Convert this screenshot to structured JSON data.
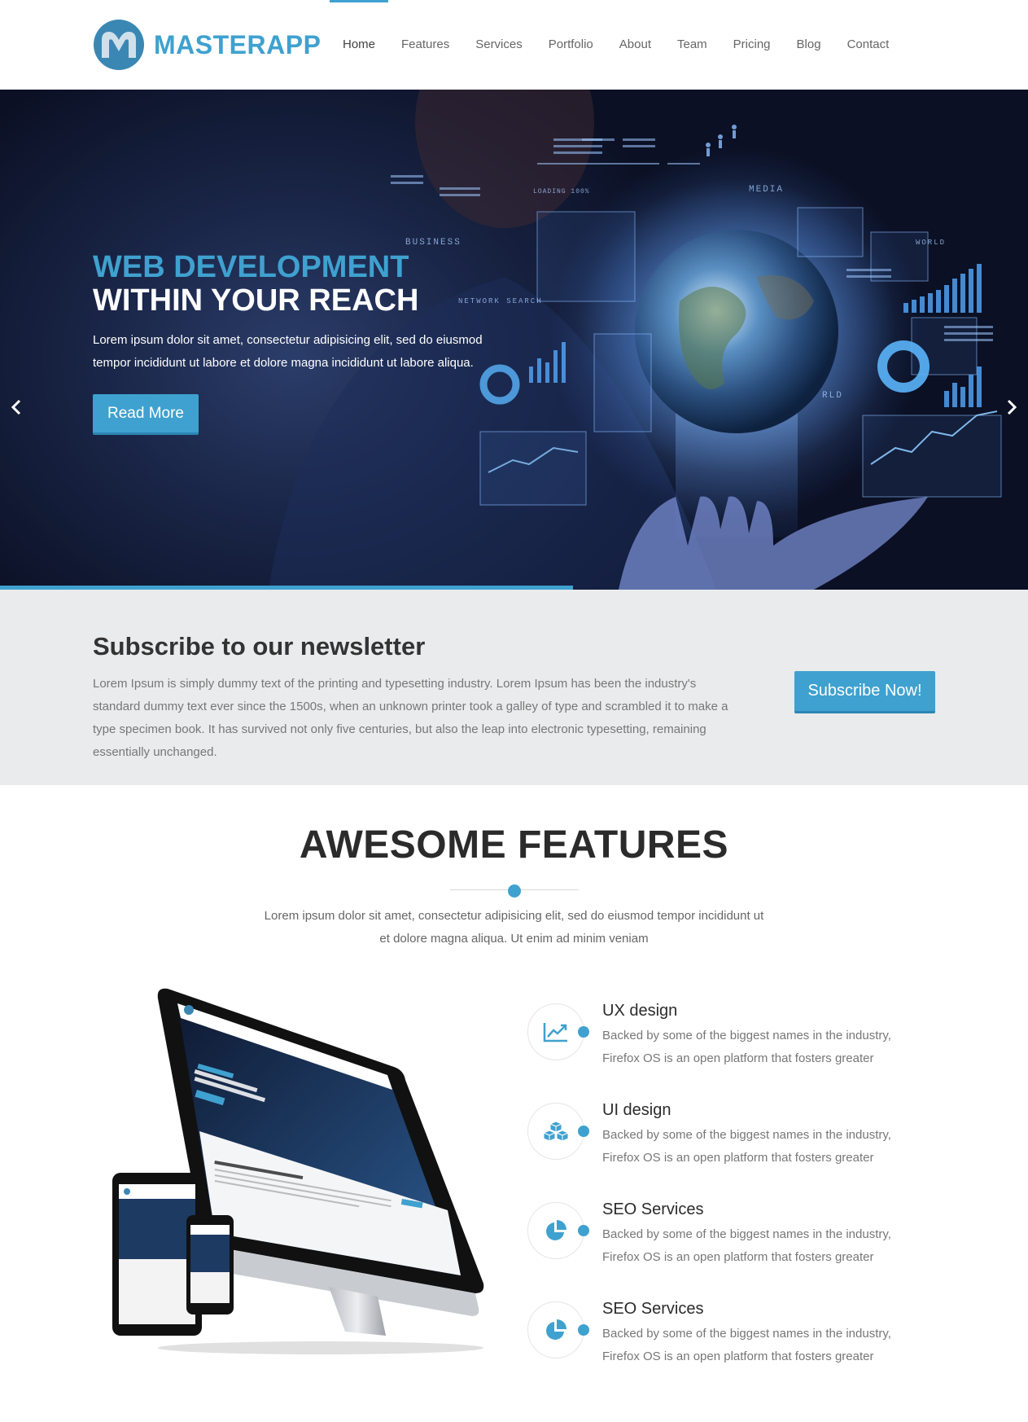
{
  "brand": {
    "name": "MASTERAPP",
    "accent": "#3fa1cf"
  },
  "nav": {
    "items": [
      "Home",
      "Features",
      "Services",
      "Portfolio",
      "About",
      "Team",
      "Pricing",
      "Blog",
      "Contact"
    ],
    "active": "Home"
  },
  "hero": {
    "title_line1": "WEB DEVELOPMENT",
    "title_line2": "WITHIN YOUR REACH",
    "description": "Lorem ipsum dolor sit amet, consectetur adipisicing elit, sed do eiusmod tempor incididunt ut labore et dolore magna incididunt ut labore aliqua.",
    "button": "Read More",
    "prev_icon": "chevron-left-icon",
    "next_icon": "chevron-right-icon"
  },
  "newsletter": {
    "title": "Subscribe to our newsletter",
    "description": "Lorem Ipsum is simply dummy text of the printing and typesetting industry. Lorem Ipsum has been the industry's standard dummy text ever since the 1500s, when an unknown printer took a galley of type and scrambled it to make a type specimen book. It has survived not only five centuries, but also the leap into electronic typesetting, remaining essentially unchanged.",
    "button": "Subscribe Now!"
  },
  "features": {
    "title": "AWESOME FEATURES",
    "description_line1": "Lorem ipsum dolor sit amet, consectetur adipisicing elit, sed do eiusmod tempor incididunt ut",
    "description_line2": "et dolore magna aliqua. Ut enim ad minim veniam",
    "items": [
      {
        "title": "UX design",
        "text": "Backed by some of the biggest names in the industry, Firefox OS is an open platform that fosters greater",
        "icon": "line-chart-icon"
      },
      {
        "title": "UI design",
        "text": "Backed by some of the biggest names in the industry, Firefox OS is an open platform that fosters greater",
        "icon": "cubes-icon"
      },
      {
        "title": "SEO Services",
        "text": "Backed by some of the biggest names in the industry, Firefox OS is an open platform that fosters greater",
        "icon": "pie-chart-icon"
      },
      {
        "title": "SEO Services",
        "text": "Backed by some of the biggest names in the industry, Firefox OS is an open platform that fosters greater",
        "icon": "pie-chart-icon"
      }
    ]
  }
}
